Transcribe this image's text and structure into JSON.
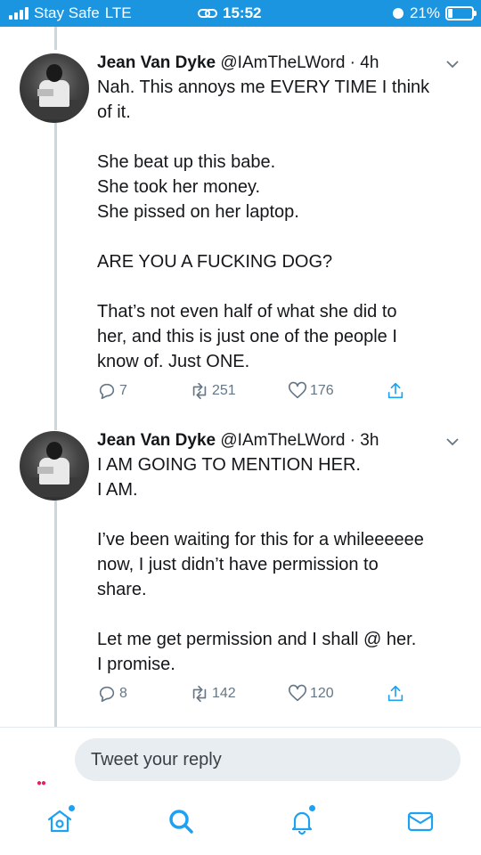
{
  "status_bar": {
    "carrier": "Stay Safe",
    "network": "LTE",
    "time": "15:52",
    "battery_percent": "21%",
    "battery_level": 0.21
  },
  "tweets": [
    {
      "name": "Jean Van Dyke",
      "handle": "@IAmTheLWord",
      "time": "· 4h",
      "lines": [
        "Nah. This annoys me EVERY TIME I think",
        "of it.",
        "",
        "She beat up this babe.",
        "She took her money.",
        "She pissed on her laptop.",
        "",
        "ARE YOU A FUCKING DOG?",
        "",
        "That’s not even half of what she did to",
        "her, and this is just one of the people I",
        "know of. Just ONE."
      ],
      "replies": "7",
      "retweets": "251",
      "likes": "176"
    },
    {
      "name": "Jean Van Dyke",
      "handle": "@IAmTheLWord",
      "time": "· 3h",
      "lines": [
        "I AM GOING TO MENTION HER.",
        "I AM.",
        "",
        "I’ve been waiting for this for a whileeeeee",
        "now, I just didn’t have permission to",
        "share.",
        "",
        "Let me get permission and I shall @ her.",
        "I promise."
      ],
      "replies": "8",
      "retweets": "142",
      "likes": "120"
    }
  ],
  "reply_bar": {
    "placeholder": "Tweet your reply"
  },
  "tab_bar": {
    "items": [
      "home-icon",
      "search-icon",
      "notifications-icon",
      "messages-icon"
    ]
  },
  "colors": {
    "status_bar": "#1b95e0",
    "accent": "#1da1f2",
    "action_gray": "#657786"
  }
}
